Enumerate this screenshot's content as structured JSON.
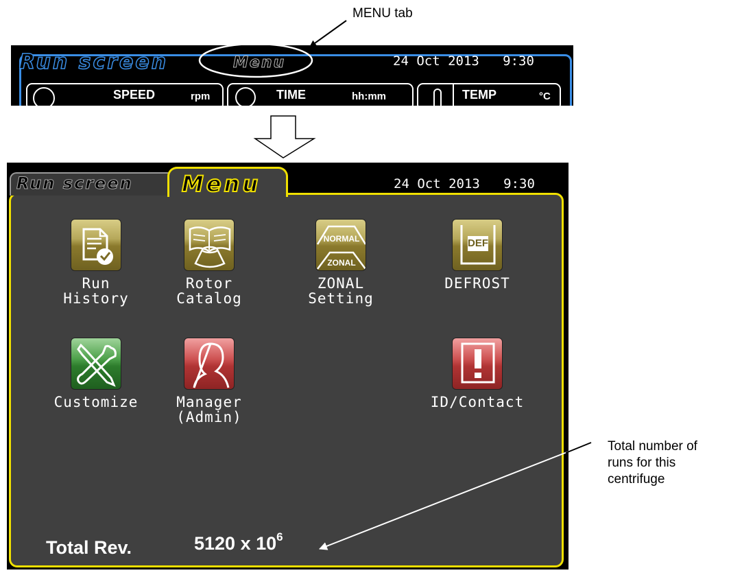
{
  "callouts": {
    "menu_tab": "MENU tab",
    "total_runs": [
      "Total number of",
      "runs for this",
      "centrifuge"
    ]
  },
  "run_screen": {
    "tab_active": "Run screen",
    "tab_menu": "Menu",
    "datetime": "24 Oct 2013   9:30",
    "readouts": {
      "speed_label": "SPEED",
      "speed_unit": "rpm",
      "time_label": "TIME",
      "time_unit": "hh:mm",
      "temp_label": "TEMP",
      "temp_unit": "°C"
    }
  },
  "menu_screen": {
    "tab_run": "Run screen",
    "tab_menu": "Menu",
    "datetime": "24 Oct 2013   9:30",
    "buttons": [
      {
        "label": "Run\nHistory",
        "icon": "run-history-icon",
        "color": "gold"
      },
      {
        "label": "Rotor\nCatalog",
        "icon": "rotor-catalog-icon",
        "color": "gold"
      },
      {
        "label": "ZONAL\nSetting",
        "icon": "zonal-setting-icon",
        "color": "gold",
        "icon_text_top": "NORMAL",
        "icon_text_bottom": "ZONAL"
      },
      {
        "label": "DEFROST",
        "icon": "defrost-icon",
        "color": "gold",
        "icon_text": "DEF"
      },
      {
        "label": "Customize",
        "icon": "customize-icon",
        "color": "green"
      },
      {
        "label": "Manager\n(Admin)",
        "icon": "manager-icon",
        "color": "red"
      },
      {
        "label": "ID/Contact",
        "icon": "id-contact-icon",
        "color": "red"
      }
    ],
    "total_rev_label": "Total Rev.",
    "total_rev_value": "5120 x 10",
    "total_rev_exponent": "6"
  },
  "colors": {
    "run_accent": "#3a8ee6",
    "menu_accent": "#f0e000",
    "panel_bg": "#404040",
    "screen_bg": "#000000"
  }
}
